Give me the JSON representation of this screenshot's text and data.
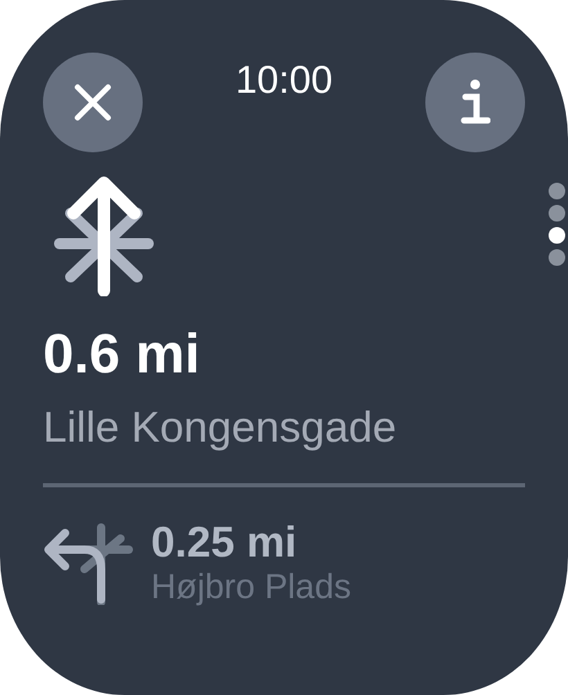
{
  "status_bar": {
    "time": "10:00"
  },
  "page_indicator": [
    {
      "selected": false
    },
    {
      "selected": false
    },
    {
      "selected": true
    },
    {
      "selected": false
    }
  ],
  "current_step": {
    "distance": "0.6 mi",
    "street": "Lille Kongensgade"
  },
  "next_step": {
    "distance": "0.25 mi",
    "street": "Højbro Plads"
  }
}
